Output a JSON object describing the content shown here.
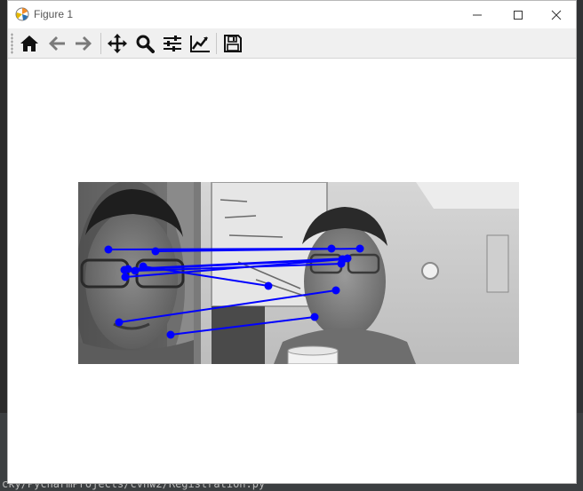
{
  "window": {
    "title": "Figure 1",
    "app_icon": "matplotlib-icon"
  },
  "background": {
    "status_path": "cky/PycharmProjects/cvhw2/Registration.py"
  },
  "toolbar": {
    "buttons": [
      {
        "name": "home",
        "icon": "home-icon"
      },
      {
        "name": "back",
        "icon": "arrow-left-icon"
      },
      {
        "name": "forward",
        "icon": "arrow-right-icon"
      },
      {
        "name": "pan",
        "icon": "move-icon"
      },
      {
        "name": "zoom",
        "icon": "magnifier-icon"
      },
      {
        "name": "subplots",
        "icon": "sliders-icon"
      },
      {
        "name": "customize",
        "icon": "line-chart-icon"
      },
      {
        "name": "save",
        "icon": "floppy-icon"
      }
    ]
  },
  "colors": {
    "match_line": "#0000ff",
    "match_point": "#0000ff"
  },
  "matches": [
    {
      "left": [
        34,
        76
      ],
      "right": [
        285,
        75
      ]
    },
    {
      "left": [
        87,
        78
      ],
      "right": [
        317,
        75
      ]
    },
    {
      "left": [
        52,
        99
      ],
      "right": [
        297,
        87
      ]
    },
    {
      "left": [
        56,
        98
      ],
      "right": [
        303,
        86
      ]
    },
    {
      "left": [
        64,
        100
      ],
      "right": [
        296,
        92
      ]
    },
    {
      "left": [
        73,
        95
      ],
      "right": [
        214,
        117
      ]
    },
    {
      "left": [
        53,
        107
      ],
      "right": [
        298,
        87
      ]
    },
    {
      "left": [
        46,
        158
      ],
      "right": [
        290,
        122
      ]
    },
    {
      "left": [
        104,
        172
      ],
      "right": [
        266,
        152
      ]
    }
  ]
}
